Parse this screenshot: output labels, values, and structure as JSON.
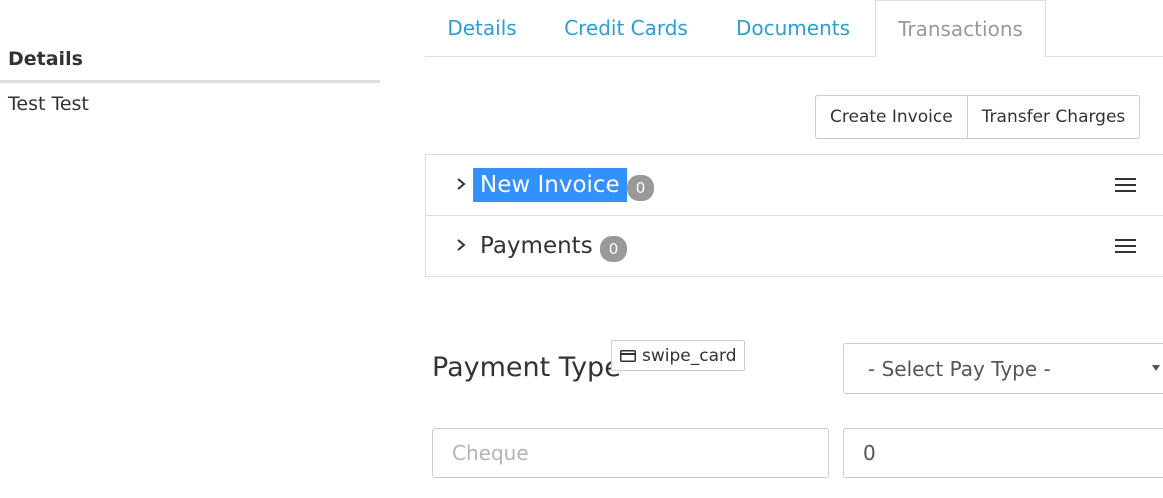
{
  "left": {
    "heading": "Details",
    "name": "Test Test"
  },
  "tabs": [
    {
      "label": "Details",
      "active": false
    },
    {
      "label": "Credit Cards",
      "active": false
    },
    {
      "label": "Documents",
      "active": false
    },
    {
      "label": "Transactions",
      "active": true
    }
  ],
  "actions": {
    "create_invoice": "Create Invoice",
    "transfer_charges": "Transfer Charges"
  },
  "accordion": [
    {
      "title": "New Invoice",
      "count": "0",
      "selected": true,
      "icon": "chevron-right-icon",
      "menu_icon": "hamburger-menu-icon"
    },
    {
      "title": "Payments",
      "count": "0",
      "selected": false,
      "icon": "chevron-right-icon",
      "menu_icon": "hamburger-menu-icon"
    }
  ],
  "payment": {
    "label": "Payment Type",
    "chip_icon": "credit-card-icon",
    "chip_text": "swipe_card",
    "select_value": "- Select Pay Type -",
    "cheque_placeholder": "Cheque",
    "amount_value": "0"
  },
  "colors": {
    "link": "#2a9fd6",
    "active_tab": "#999999",
    "selection": "#3390ff",
    "badge": "#999999",
    "border": "#dddddd"
  }
}
